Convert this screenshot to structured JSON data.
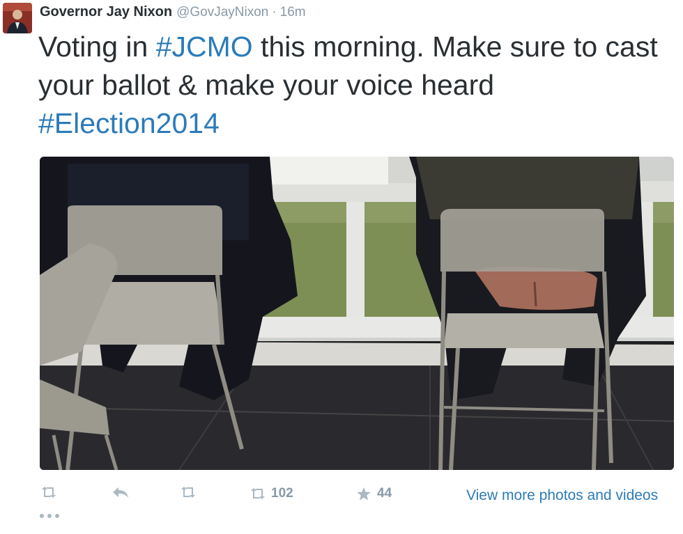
{
  "tweet": {
    "author": {
      "fullname": "Governor Jay Nixon",
      "username": "@GovJayNixon",
      "separator": "·",
      "time": "16m"
    },
    "text": {
      "part1": "Voting in ",
      "hashtag1": "#JCMO",
      "part2": " this morning. Make sure to cast your ballot & make your voice heard ",
      "hashtag2": "#Election2014"
    },
    "actions": {
      "retweet_count": "102",
      "favorite_count": "44",
      "view_more_label": "View more photos and videos"
    }
  },
  "colors": {
    "link": "#2b7bb9",
    "muted": "#8899a6",
    "icon": "#aab8c2"
  },
  "icons": [
    "retweet-icon",
    "reply-icon",
    "favorite-icon",
    "more-icon"
  ]
}
